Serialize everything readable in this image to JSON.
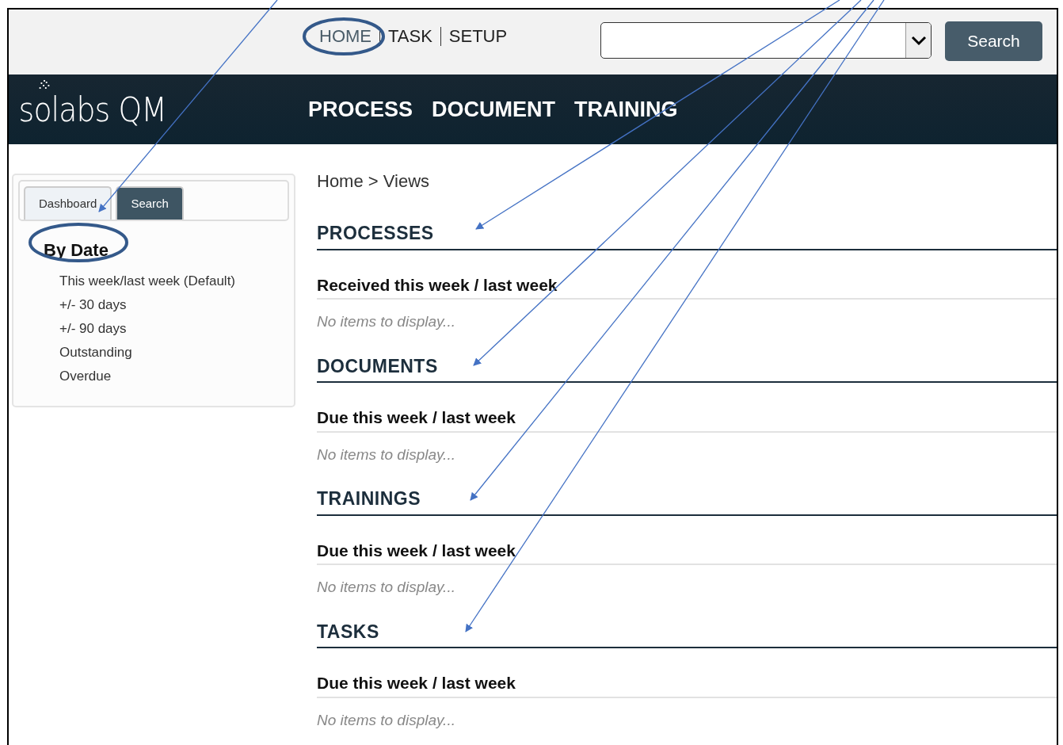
{
  "top_nav": [
    {
      "label": "HOME",
      "selected": true
    },
    {
      "label": "TASK",
      "selected": false
    },
    {
      "label": "SETUP",
      "selected": false
    }
  ],
  "search": {
    "button": "Search"
  },
  "brand": "solabs QM",
  "main_nav": [
    "PROCESS",
    "DOCUMENT",
    "TRAINING"
  ],
  "sidebar": {
    "tabs": [
      {
        "label": "Dashboard",
        "selected": true
      },
      {
        "label": "Search",
        "selected": false
      }
    ],
    "group": "By Date",
    "items": [
      "This week/last week (Default)",
      "+/- 30 days",
      "+/- 90 days",
      "Outstanding",
      "Overdue"
    ]
  },
  "breadcrumb": "Home > Views",
  "sections": [
    {
      "title": "PROCESSES",
      "subtitle": "Received this week / last week",
      "empty": "No items to display..."
    },
    {
      "title": "DOCUMENTS",
      "subtitle": "Due this week / last week",
      "empty": "No items to display..."
    },
    {
      "title": "TRAININGS",
      "subtitle": "Due this week / last week",
      "empty": "No items to display..."
    },
    {
      "title": "TASKS",
      "subtitle": "Due this week / last week",
      "empty": "No items to display..."
    }
  ]
}
